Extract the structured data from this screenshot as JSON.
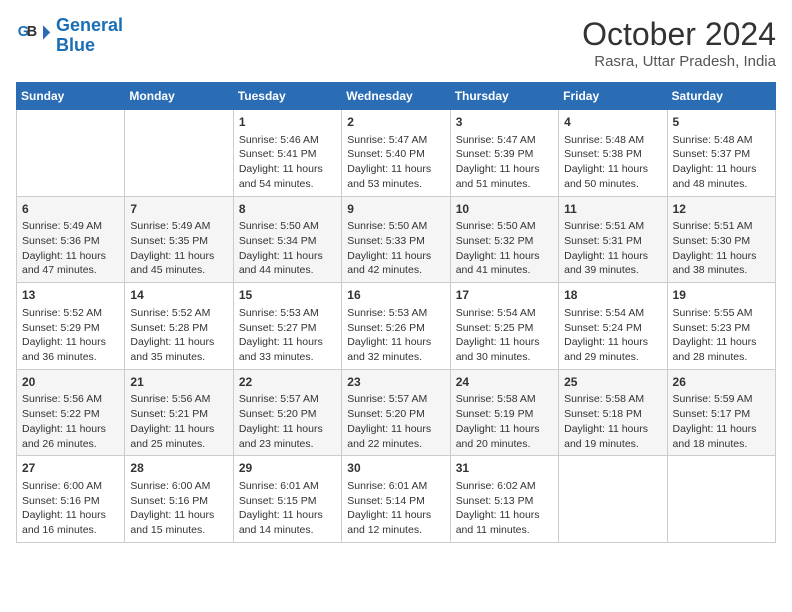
{
  "logo": {
    "line1": "General",
    "line2": "Blue"
  },
  "title": "October 2024",
  "subtitle": "Rasra, Uttar Pradesh, India",
  "days_of_week": [
    "Sunday",
    "Monday",
    "Tuesday",
    "Wednesday",
    "Thursday",
    "Friday",
    "Saturday"
  ],
  "weeks": [
    [
      {
        "day": "",
        "info": ""
      },
      {
        "day": "",
        "info": ""
      },
      {
        "day": "1",
        "info": "Sunrise: 5:46 AM\nSunset: 5:41 PM\nDaylight: 11 hours and 54 minutes."
      },
      {
        "day": "2",
        "info": "Sunrise: 5:47 AM\nSunset: 5:40 PM\nDaylight: 11 hours and 53 minutes."
      },
      {
        "day": "3",
        "info": "Sunrise: 5:47 AM\nSunset: 5:39 PM\nDaylight: 11 hours and 51 minutes."
      },
      {
        "day": "4",
        "info": "Sunrise: 5:48 AM\nSunset: 5:38 PM\nDaylight: 11 hours and 50 minutes."
      },
      {
        "day": "5",
        "info": "Sunrise: 5:48 AM\nSunset: 5:37 PM\nDaylight: 11 hours and 48 minutes."
      }
    ],
    [
      {
        "day": "6",
        "info": "Sunrise: 5:49 AM\nSunset: 5:36 PM\nDaylight: 11 hours and 47 minutes."
      },
      {
        "day": "7",
        "info": "Sunrise: 5:49 AM\nSunset: 5:35 PM\nDaylight: 11 hours and 45 minutes."
      },
      {
        "day": "8",
        "info": "Sunrise: 5:50 AM\nSunset: 5:34 PM\nDaylight: 11 hours and 44 minutes."
      },
      {
        "day": "9",
        "info": "Sunrise: 5:50 AM\nSunset: 5:33 PM\nDaylight: 11 hours and 42 minutes."
      },
      {
        "day": "10",
        "info": "Sunrise: 5:50 AM\nSunset: 5:32 PM\nDaylight: 11 hours and 41 minutes."
      },
      {
        "day": "11",
        "info": "Sunrise: 5:51 AM\nSunset: 5:31 PM\nDaylight: 11 hours and 39 minutes."
      },
      {
        "day": "12",
        "info": "Sunrise: 5:51 AM\nSunset: 5:30 PM\nDaylight: 11 hours and 38 minutes."
      }
    ],
    [
      {
        "day": "13",
        "info": "Sunrise: 5:52 AM\nSunset: 5:29 PM\nDaylight: 11 hours and 36 minutes."
      },
      {
        "day": "14",
        "info": "Sunrise: 5:52 AM\nSunset: 5:28 PM\nDaylight: 11 hours and 35 minutes."
      },
      {
        "day": "15",
        "info": "Sunrise: 5:53 AM\nSunset: 5:27 PM\nDaylight: 11 hours and 33 minutes."
      },
      {
        "day": "16",
        "info": "Sunrise: 5:53 AM\nSunset: 5:26 PM\nDaylight: 11 hours and 32 minutes."
      },
      {
        "day": "17",
        "info": "Sunrise: 5:54 AM\nSunset: 5:25 PM\nDaylight: 11 hours and 30 minutes."
      },
      {
        "day": "18",
        "info": "Sunrise: 5:54 AM\nSunset: 5:24 PM\nDaylight: 11 hours and 29 minutes."
      },
      {
        "day": "19",
        "info": "Sunrise: 5:55 AM\nSunset: 5:23 PM\nDaylight: 11 hours and 28 minutes."
      }
    ],
    [
      {
        "day": "20",
        "info": "Sunrise: 5:56 AM\nSunset: 5:22 PM\nDaylight: 11 hours and 26 minutes."
      },
      {
        "day": "21",
        "info": "Sunrise: 5:56 AM\nSunset: 5:21 PM\nDaylight: 11 hours and 25 minutes."
      },
      {
        "day": "22",
        "info": "Sunrise: 5:57 AM\nSunset: 5:20 PM\nDaylight: 11 hours and 23 minutes."
      },
      {
        "day": "23",
        "info": "Sunrise: 5:57 AM\nSunset: 5:20 PM\nDaylight: 11 hours and 22 minutes."
      },
      {
        "day": "24",
        "info": "Sunrise: 5:58 AM\nSunset: 5:19 PM\nDaylight: 11 hours and 20 minutes."
      },
      {
        "day": "25",
        "info": "Sunrise: 5:58 AM\nSunset: 5:18 PM\nDaylight: 11 hours and 19 minutes."
      },
      {
        "day": "26",
        "info": "Sunrise: 5:59 AM\nSunset: 5:17 PM\nDaylight: 11 hours and 18 minutes."
      }
    ],
    [
      {
        "day": "27",
        "info": "Sunrise: 6:00 AM\nSunset: 5:16 PM\nDaylight: 11 hours and 16 minutes."
      },
      {
        "day": "28",
        "info": "Sunrise: 6:00 AM\nSunset: 5:16 PM\nDaylight: 11 hours and 15 minutes."
      },
      {
        "day": "29",
        "info": "Sunrise: 6:01 AM\nSunset: 5:15 PM\nDaylight: 11 hours and 14 minutes."
      },
      {
        "day": "30",
        "info": "Sunrise: 6:01 AM\nSunset: 5:14 PM\nDaylight: 11 hours and 12 minutes."
      },
      {
        "day": "31",
        "info": "Sunrise: 6:02 AM\nSunset: 5:13 PM\nDaylight: 11 hours and 11 minutes."
      },
      {
        "day": "",
        "info": ""
      },
      {
        "day": "",
        "info": ""
      }
    ]
  ]
}
